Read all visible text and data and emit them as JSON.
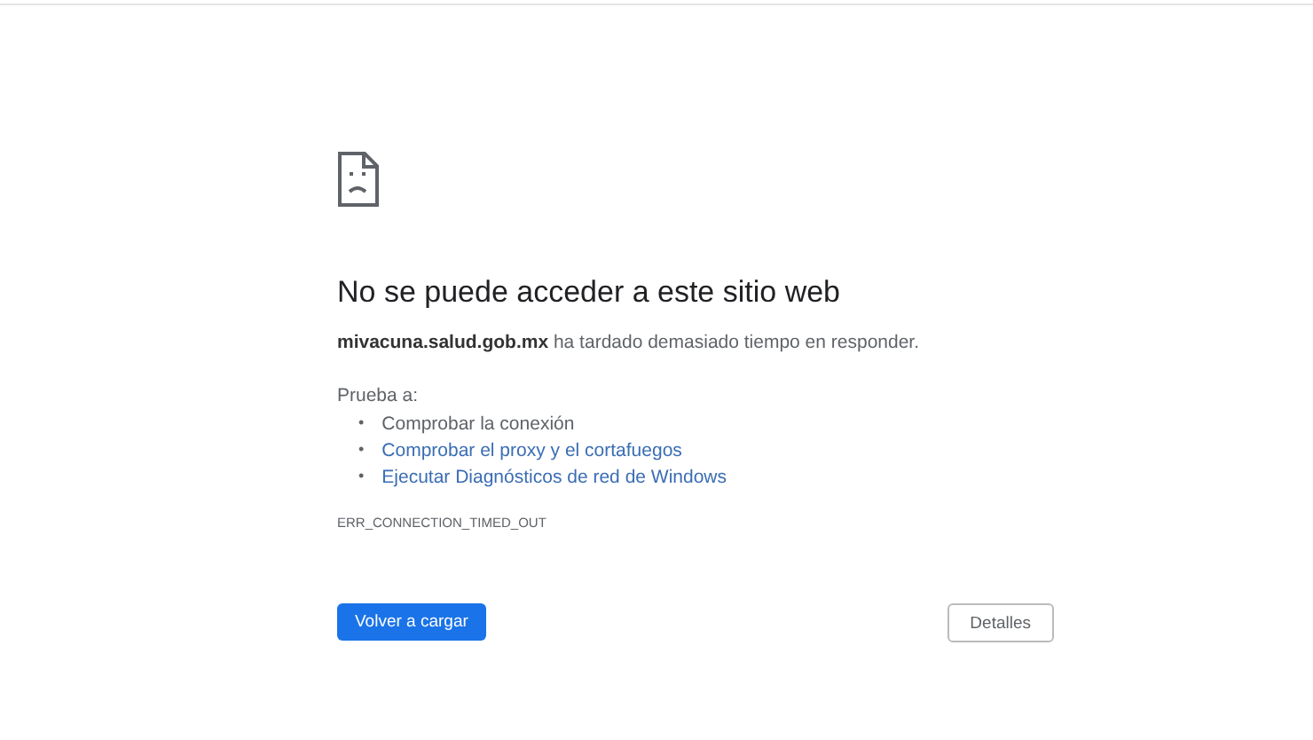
{
  "title": "No se puede acceder a este sitio web",
  "message": {
    "text": "**mivacuna.salud.gob.mx** ha tardado demasiado tiempo en responder."
  },
  "suggestions_heading": "Prueba a:",
  "suggestions": [
    {
      "bullet": "•",
      "label": "Comprobar la conexión",
      "kind": "text"
    },
    {
      "bullet": "•",
      "label": "Comprobar el proxy y el cortafuegos",
      "kind": "link"
    },
    {
      "bullet": "•",
      "label": "Ejecutar Diagnósticos de red de Windows",
      "kind": "link"
    }
  ],
  "error_code": "ERR_CONNECTION_TIMED_OUT",
  "buttons": [
    {
      "label": "Volver a cargar",
      "kind": "primary"
    },
    {
      "label": "Detalles",
      "kind": "secondary"
    }
  ]
}
